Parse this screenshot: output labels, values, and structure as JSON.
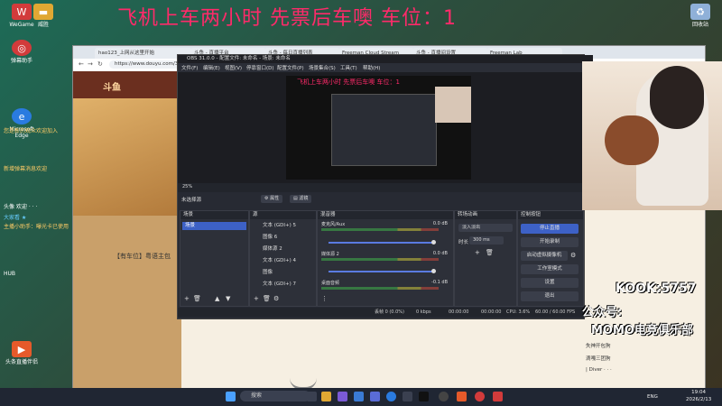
{
  "banner": {
    "text": "飞机上车两小时  先票后车噢  车位：1"
  },
  "desktop_icons": [
    {
      "label": "WeGame",
      "color": "#d23b3b"
    },
    {
      "label": "威胜",
      "color": "#e0a833"
    },
    {
      "label": "弹幕助手",
      "color": "#d23b3b"
    },
    {
      "label": "Microsoft Edge",
      "color": "#2a7be0"
    },
    {
      "label": "头条直播伴侣",
      "color": "#e65a2a"
    },
    {
      "label": "回收站",
      "color": "#8fb0d8"
    }
  ],
  "browser": {
    "tabs": [
      "hao123_上网从这里开始",
      "斗鱼 - 直播平台",
      "斗鱼 - 每日直播列表",
      "Freeman Cloud Stream",
      "斗鱼 - 直播间设置",
      "Freeman Lab"
    ],
    "url": "https://www.douyu.com/31..."
  },
  "page": {
    "room_title": "【有车位】粤语主包",
    "right_list": [
      "失神开包狗",
      "滴嘎三团狗",
      "| Diver · · ·"
    ]
  },
  "chat_overlay": [
    "您是新的观众欢迎加入",
    "新增弹幕消息欢迎",
    "头像 欢迎 · · ·",
    "大家看 ★",
    "主播小助手：曝光卡已使用",
    "【有车位】粤语主包",
    "HUB"
  ],
  "obs": {
    "title": "OBS 31.0.0 - 配置文件: 未命名 - 场景: 未命名",
    "menu": [
      "文件(F)",
      "编辑(E)",
      "视图(V)",
      "停靠窗口(D)",
      "配置文件(P)",
      "场景集合(S)",
      "工具(T)",
      "帮助(H)"
    ],
    "preview_banner": "飞机上车两小时  先票后车噢  车位：1",
    "toolbar_zoom": "25%",
    "no_source_selected": "未选择源",
    "props_button": "属性",
    "filters_button": "滤镜",
    "docks": {
      "scenes": {
        "title": "场景",
        "items": [
          "场景"
        ]
      },
      "sources": {
        "title": "源",
        "items": [
          "文本 (GDI+) 5",
          "图像 6",
          "媒体源 2",
          "文本 (GDI+) 4",
          "图像",
          "文本 (GDI+) 7"
        ]
      },
      "mixer": {
        "title": "混音器",
        "channels": [
          {
            "name": "麦克风/Aux",
            "db": "0.0 dB"
          },
          {
            "name": "媒体源 2",
            "db": "0.0 dB"
          },
          {
            "name": "桌面音频",
            "db": "-0.1 dB"
          }
        ]
      },
      "transitions": {
        "title": "转场动画",
        "type": "淡入淡出",
        "duration_label": "时长",
        "duration": "300 ms"
      },
      "controls": {
        "title": "控制按钮",
        "buttons": [
          "停止直播",
          "开始录制",
          "启动虚拟摄像机",
          "工作室模式",
          "设置",
          "退出"
        ]
      }
    },
    "status": {
      "dropped": "丢帧 0 (0.0%)",
      "bitrate": "0 kbps",
      "live_time": "00:00:00",
      "rec_time": "00:00:00",
      "cpu": "CPU: 3.6%",
      "fps": "60.00 / 60.00 FPS"
    }
  },
  "overlay_text": {
    "kook": "KOOK:5757",
    "gzh": "公众号:",
    "club": "MOMO电竞俱乐部"
  },
  "taskbar": {
    "search": "搜索",
    "lang": "ENG",
    "time": "19:04",
    "date": "2026/2/13"
  }
}
